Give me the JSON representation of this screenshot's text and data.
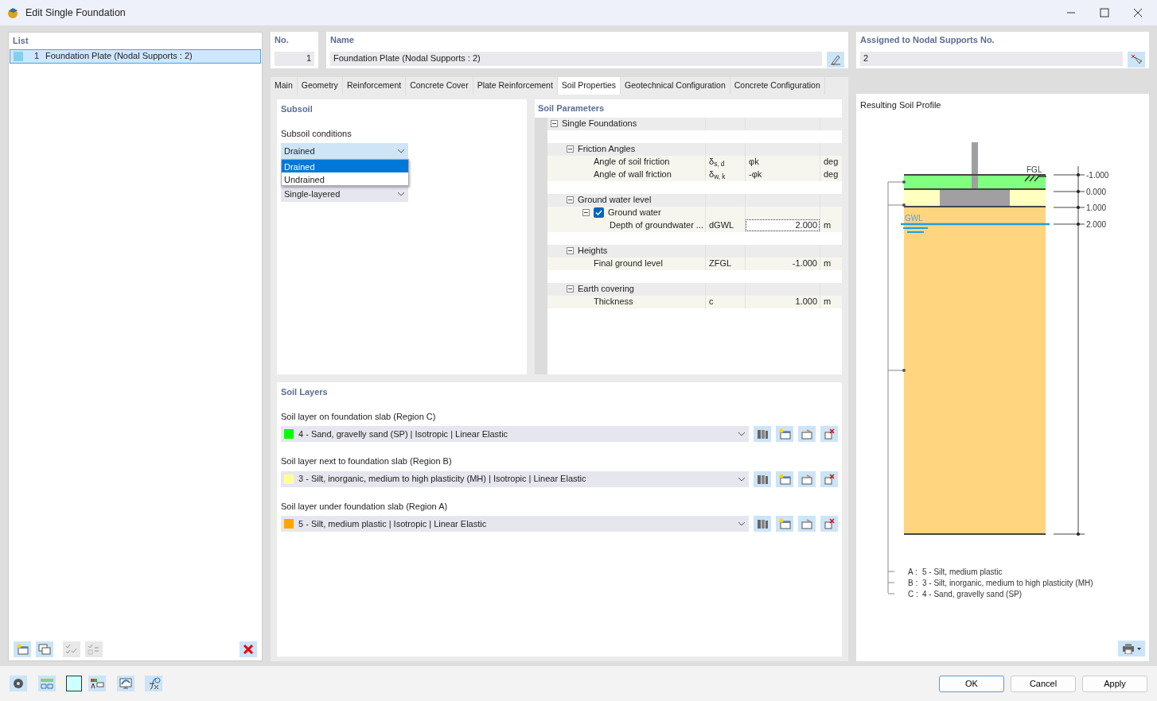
{
  "window": {
    "title": "Edit Single Foundation"
  },
  "list": {
    "title": "List",
    "items": [
      {
        "number": "1",
        "label": "Foundation Plate (Nodal Supports : 2)",
        "selected": true,
        "color": "#87ceeb"
      }
    ]
  },
  "number_field": {
    "label": "No.",
    "value": "1"
  },
  "name_field": {
    "label": "Name",
    "value": "Foundation Plate (Nodal Supports : 2)"
  },
  "assigned_field": {
    "label": "Assigned to Nodal Supports No.",
    "value": "2"
  },
  "tabs": [
    {
      "label": "Main",
      "selected": false
    },
    {
      "label": "Geometry",
      "selected": false
    },
    {
      "label": "Reinforcement",
      "selected": false
    },
    {
      "label": "Concrete Cover",
      "selected": false
    },
    {
      "label": "Plate Reinforcement",
      "selected": false
    },
    {
      "label": "Soil Properties",
      "selected": true
    },
    {
      "label": "Geotechnical Configuration",
      "selected": false
    },
    {
      "label": "Concrete Configuration",
      "selected": false
    }
  ],
  "subsoil": {
    "title": "Subsoil",
    "conditions_label": "Subsoil conditions",
    "conditions_value": "Drained",
    "dropdown_options": [
      {
        "label": "Drained",
        "selected": true
      },
      {
        "label": "Undrained",
        "selected": false
      }
    ],
    "layering_value": "Single-layered"
  },
  "soil_parameters": {
    "title": "Soil Parameters",
    "tree": [
      {
        "kind": "group",
        "label": "Single Foundations",
        "expanded": true,
        "children": [
          {
            "kind": "group",
            "label": "Friction Angles",
            "expanded": true,
            "children": [
              {
                "kind": "row",
                "label": "Angle of soil friction",
                "symbol": "δ$_{s, d}$",
                "value": "φk",
                "unit": "deg"
              },
              {
                "kind": "row",
                "label": "Angle of wall friction",
                "symbol": "δ$_{w, k}$",
                "value": "-φk",
                "unit": "deg"
              }
            ]
          },
          {
            "kind": "group",
            "label": "Ground water level",
            "expanded": true,
            "children": [
              {
                "kind": "check",
                "label": "Ground water",
                "expanded": true,
                "checked": true,
                "children": [
                  {
                    "kind": "input",
                    "label": "Depth of groundwater ...",
                    "symbol": "dGWL",
                    "value": "2.000",
                    "unit": "m"
                  }
                ]
              }
            ]
          },
          {
            "kind": "group",
            "label": "Heights",
            "expanded": true,
            "children": [
              {
                "kind": "number",
                "label": "Final ground level",
                "symbol": "ZFGL",
                "value": "-1.000",
                "unit": "m"
              }
            ]
          },
          {
            "kind": "group",
            "label": "Earth covering",
            "expanded": true,
            "children": [
              {
                "kind": "number",
                "label": "Thickness",
                "symbol": "c",
                "value": "1.000",
                "unit": "m"
              }
            ]
          }
        ]
      }
    ]
  },
  "soil_layers": {
    "title": "Soil Layers",
    "layers": [
      {
        "label": "Soil layer on foundation slab (Region C)",
        "value": "4 - Sand, gravelly sand (SP) | Isotropic | Linear Elastic",
        "color": "#00ff00"
      },
      {
        "label": "Soil layer next to foundation slab (Region B)",
        "value": "3 - Silt, inorganic, medium to high plasticity (MH) | Isotropic | Linear Elastic",
        "color": "#ffff99"
      },
      {
        "label": "Soil layer under foundation slab (Region A)",
        "value": "5 - Silt, medium plastic | Isotropic | Linear Elastic",
        "color": "#ffa500"
      }
    ]
  },
  "soil_profile": {
    "title": "Resulting Soil Profile",
    "fgl_label": "FGL",
    "gwl_label": "GWL",
    "levels": [
      "-1.000",
      "0.000",
      "1.000",
      "2.000"
    ],
    "legend": [
      {
        "region": "A :",
        "text": "5 - Silt, medium plastic"
      },
      {
        "region": "B :",
        "text": "3 - Silt, inorganic, medium to high plasticity (MH)"
      },
      {
        "region": "C :",
        "text": "4 - Sand, gravelly sand (SP)"
      }
    ]
  },
  "buttons": [
    {
      "label": "OK",
      "default": true
    },
    {
      "label": "Cancel",
      "default": false
    },
    {
      "label": "Apply",
      "default": false
    }
  ]
}
